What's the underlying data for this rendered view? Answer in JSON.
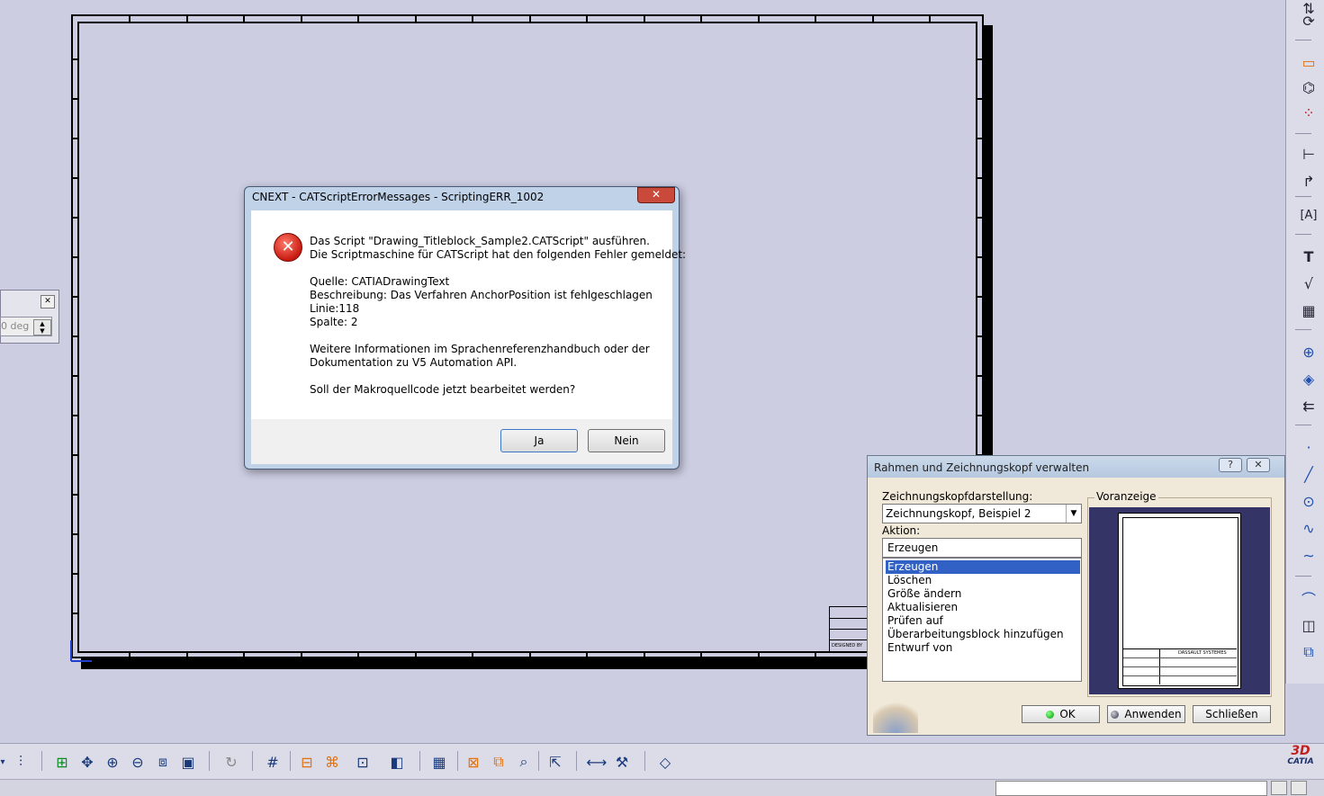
{
  "error_dialog": {
    "title": "CNEXT - CATScriptErrorMessages - ScriptingERR_1002",
    "close_glyph": "✕",
    "lines": [
      "Das Script \"Drawing_Titleblock_Sample2.CATScript\" ausführen.",
      "Die Scriptmaschine für CATScript hat den folgenden Fehler gemeldet:",
      "Quelle: CATIADrawingText",
      "Beschreibung: Das Verfahren AnchorPosition ist fehlgeschlagen",
      "Linie:118",
      "Spalte: 2",
      "Weitere Informationen im Sprachenreferenzhandbuch oder der",
      "Dokumentation zu V5 Automation API.",
      "Soll der Makroquellcode jetzt bearbeitet werden?"
    ],
    "yes_label": "Ja",
    "no_label": "Nein"
  },
  "titleblock_dialog": {
    "title": "Rahmen und Zeichnungskopf verwalten",
    "help_glyph": "?",
    "close_glyph": "✕",
    "style_label": "Zeichnungskopfdarstellung:",
    "style_value": "Zeichnungskopf, Beispiel 2",
    "action_label": "Aktion:",
    "action_value": "Erzeugen",
    "actions": [
      "Erzeugen",
      "Löschen",
      "Größe ändern",
      "Aktualisieren",
      "Prüfen auf",
      "Überarbeitungsblock hinzufügen",
      "Entwurf von"
    ],
    "selected_action_index": 0,
    "preview_label": "Voranzeige",
    "preview_company": "DASSAULT SYSTEMES",
    "ok_label": "OK",
    "apply_label": "Anwenden",
    "close_label": "Schließen"
  },
  "palette": {
    "angle_value": "0 deg",
    "close_glyph": "✕"
  },
  "sheet": {
    "titleblock_tag": "DESIGNED BY"
  },
  "logo": {
    "text": "CATIA"
  },
  "icons": {
    "right_toolbar": [
      "sheet-icon",
      "sheet-rotate-icon",
      "new-view-icon",
      "view-from-3d-icon",
      "section-view-icon",
      "dimension-icon",
      "dimension-chain-icon",
      "text-frame-icon",
      "text-icon",
      "roughness-icon",
      "table-icon",
      "axis-icon",
      "fill-icon",
      "arrow-icon",
      "point-icon",
      "line-icon",
      "circle-icon",
      "spline-icon",
      "curve-icon",
      "arc-icon",
      "symmetry-icon",
      "3d-view-icon"
    ],
    "bottom_toolbar": [
      "dropdown-icon",
      "macro-icon",
      "fit-all-icon",
      "pan-icon",
      "zoom-in-icon",
      "zoom-out-icon",
      "normal-view-icon",
      "view-mode-icon",
      "refresh-icon",
      "grid-icon",
      "snap-icon",
      "analysis-icon",
      "display-icon",
      "dimension-mode-icon",
      "grid2-icon",
      "filter-icon",
      "overlap-icon",
      "search-icon",
      "export-icon",
      "measure-icon",
      "tools-icon",
      "layer-icon"
    ]
  }
}
